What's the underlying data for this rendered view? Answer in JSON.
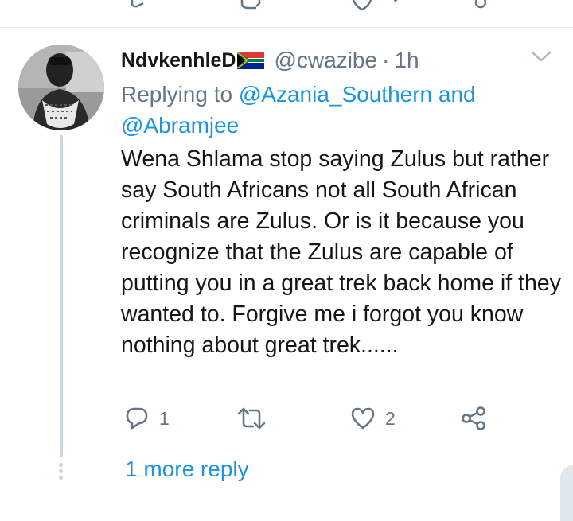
{
  "colors": {
    "link": "#1b95e0",
    "muted": "#657786",
    "text": "#14171a",
    "line": "#ccd6dd"
  },
  "tweet": {
    "display_name": "NdvkenhleD",
    "name_emoji": "south-africa-flag",
    "handle": "@cwazibe",
    "separator": "·",
    "time": "1h",
    "replying_prefix": "Replying to",
    "replying_user1": "@Azania_Southern",
    "replying_and": "and",
    "replying_user2": "@Abramjee",
    "body": "Wena Shlama stop saying Zulus but rather say South Africans not all South African criminals are Zulus. Or is it because you recognize that the Zulus are capable of putting you in a great trek back home if they wanted to. Forgive me i forgot you know nothing about great trek......",
    "reply_count": "1",
    "retweet_count": "",
    "like_count": "2",
    "icons": [
      "reply-icon",
      "retweet-icon",
      "like-icon",
      "share-icon",
      "chevron-down-icon"
    ]
  },
  "thread": {
    "more_replies_label": "1 more reply"
  }
}
